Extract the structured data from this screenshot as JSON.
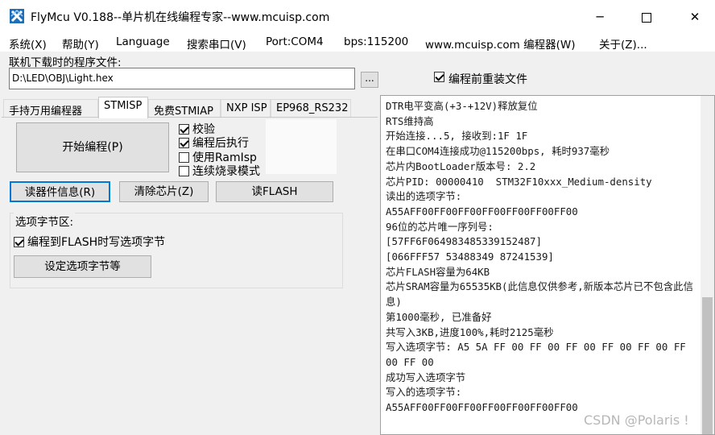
{
  "window": {
    "title": "FlyMcu V0.188--单片机在线编程专家--www.mcuisp.com",
    "icon": "flymcu-logo-icon",
    "minimize": "─",
    "maximize": "",
    "close": "✕"
  },
  "menu": [
    {
      "label": "系统(X)"
    },
    {
      "label": "帮助(Y)"
    },
    {
      "label": "Language"
    },
    {
      "label": "搜索串口(V)"
    },
    {
      "label": "Port:COM4"
    },
    {
      "label": "bps:115200"
    },
    {
      "label": "www.mcuisp.com 编程器(W)"
    },
    {
      "label": "关于(Z)..."
    }
  ],
  "file": {
    "label": "联机下载时的程序文件:",
    "path": "D:\\LED\\OBJ\\Light.hex",
    "browse": "...",
    "reload_label": "编程前重装文件",
    "reload_checked": true
  },
  "tabs": [
    {
      "label": "手持万用编程器",
      "active": false
    },
    {
      "label": "STMISP",
      "active": true
    },
    {
      "label": "免费STMIAP",
      "active": false
    },
    {
      "label": "NXP ISP",
      "active": false
    },
    {
      "label": "EP968_RS232",
      "active": false
    }
  ],
  "buttons": {
    "start": "开始编程(P)",
    "read_info": "读器件信息(R)",
    "erase": "清除芯片(Z)",
    "read_flash": "读FLASH",
    "set_option": "设定选项字节等"
  },
  "options": [
    {
      "label": "校验",
      "checked": true
    },
    {
      "label": "编程后执行",
      "checked": true
    },
    {
      "label": "使用RamIsp",
      "checked": false
    },
    {
      "label": "连续烧录模式",
      "checked": false
    }
  ],
  "option_group": {
    "title": "选项字节区:",
    "write_option_label": "编程到FLASH时写选项字节",
    "write_option_checked": true
  },
  "log": [
    "DTR电平变高(+3-+12V)释放复位",
    "RTS维持高",
    "开始连接...5, 接收到:1F 1F",
    "在串口COM4连接成功@115200bps, 耗时937毫秒",
    "芯片内BootLoader版本号: 2.2",
    "芯片PID: 00000410  STM32F10xxx_Medium-density",
    "读出的选项字节:",
    "A55AFF00FF00FF00FF00FF00FF00FF00",
    "96位的芯片唯一序列号:",
    "[57FF6F064983485339152487]",
    "[066FFF57 53488349 87241539]",
    "芯片FLASH容量为64KB",
    "芯片SRAM容量为65535KB(此信息仅供参考,新版本芯片已不包含此信息)",
    "第1000毫秒, 已准备好",
    "共写入3KB,进度100%,耗时2125毫秒",
    "写入选项字节: A5 5A FF 00 FF 00 FF 00 FF 00 FF 00 FF 00 FF 00",
    "成功写入选项字节",
    "写入的选项字节:",
    "A55AFF00FF00FF00FF00FF00FF00FF00"
  ],
  "watermark": "CSDN @Polaris !",
  "colors": {
    "accent": "#0078d7",
    "background": "#f0f0f0",
    "log_background": "#ffffff"
  }
}
